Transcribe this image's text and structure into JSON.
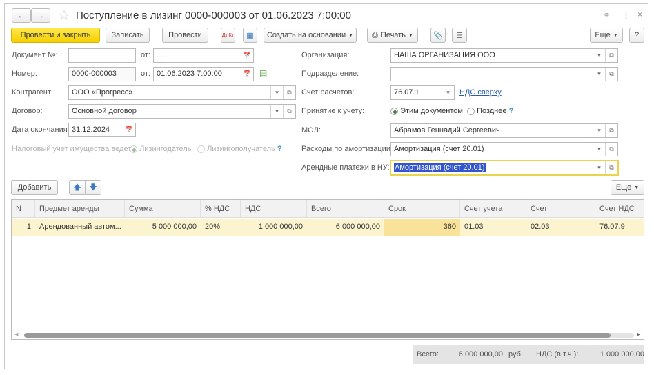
{
  "window": {
    "title": "Поступление в лизинг 0000-000003 от 01.06.2023 7:00:00"
  },
  "toolbar": {
    "post_close": "Провести и закрыть",
    "save": "Записать",
    "post": "Провести",
    "dt_kt": "Дт Кт",
    "create_based": "Создать на основании",
    "print": "Печать",
    "more": "Еще",
    "help": "?"
  },
  "form": {
    "doc_no_label": "Документ №:",
    "doc_no_value": "",
    "from_label": "от:",
    "doc_date_value": " .  . ",
    "number_label": "Номер:",
    "number_value": "0000-000003",
    "number_from_label": "от:",
    "number_date_value": "01.06.2023  7:00:00",
    "counterparty_label": "Контрагент:",
    "counterparty_value": "ООО «Прогресс»",
    "contract_label": "Договор:",
    "contract_value": "Основной договор",
    "end_date_label": "Дата окончания:",
    "end_date_value": "31.12.2024",
    "tax_label": "Налоговый учет имущества ведет:",
    "tax_opt1": "Лизингодатель",
    "tax_opt2": "Лизингополучатель",
    "org_label": "Организация:",
    "org_value": "НАША ОРГАНИЗАЦИЯ ООО",
    "dept_label": "Подразделение:",
    "dept_value": "",
    "account_label": "Счет расчетов:",
    "account_value": "76.07.1",
    "vat_link": "НДС сверху",
    "acceptance_label": "Принятие к учету:",
    "acceptance_opt1": "Этим документом",
    "acceptance_opt2": "Позднее",
    "mol_label": "МОЛ:",
    "mol_value": "Абрамов Геннадий Сергеевич",
    "depr_label": "Расходы по амортизации:",
    "depr_value": "Амортизация (счет 20.01)",
    "lease_label": "Арендные платежи в НУ:",
    "lease_value": "Амортизация (счет 20.01)"
  },
  "table": {
    "add": "Добавить",
    "more": "Еще",
    "columns": [
      "N",
      "Предмет аренды",
      "Сумма",
      "% НДС",
      "НДС",
      "Всего",
      "Срок использования",
      "Счет учета",
      "Счет амортизации",
      "Счет НДС"
    ],
    "rows": [
      [
        "1",
        "Арендованный автом...",
        "5 000 000,00",
        "20%",
        "1 000 000,00",
        "6 000 000,00",
        "360",
        "01.03",
        "02.03",
        "76.07.9"
      ]
    ]
  },
  "footer": {
    "total_label": "Всего:",
    "total_value": "6 000 000,00",
    "currency": "руб.",
    "vat_label": "НДС (в т.ч.):",
    "vat_value": "1 000 000,00"
  },
  "colors": {
    "primary_button": "#f5cf00",
    "selected_row": "#fcf3cf",
    "focus_border": "#e8d44d",
    "selection": "#3355cc",
    "link": "#2a5db0"
  }
}
